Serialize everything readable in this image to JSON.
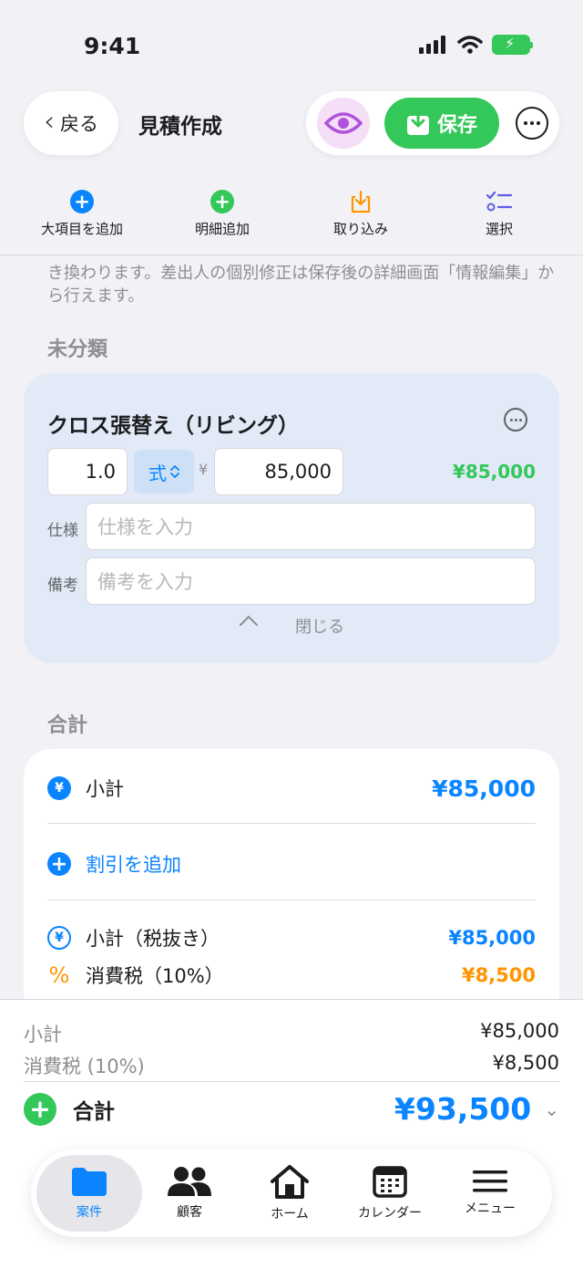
{
  "status": {
    "time": "9:41"
  },
  "nav": {
    "back_label": "戻る",
    "title": "見積作成",
    "save_label": "保存"
  },
  "toolbar": {
    "add_major": "大項目を追加",
    "add_detail": "明細追加",
    "import": "取り込み",
    "select": "選択"
  },
  "note": "き換わります。差出人の個別修正は保存後の詳細画面「情報編集」から行えます。",
  "section_uncategorized": "未分類",
  "item": {
    "name": "クロス張替え（リビング）",
    "quantity": "1.0",
    "unit": "式",
    "yen": "¥",
    "price": "85,000",
    "line_total": "¥85,000",
    "spec_label": "仕様",
    "spec_placeholder": "仕様を入力",
    "memo_label": "備考",
    "memo_placeholder": "備考を入力",
    "close_label": "閉じる"
  },
  "section_total": "合計",
  "totals": {
    "subtotal_label": "小計",
    "subtotal_value": "¥85,000",
    "add_discount": "割引を追加",
    "subtotal_ex_tax_label": "小計（税抜き）",
    "subtotal_ex_tax_value": "¥85,000",
    "tax_label": "消費税（10%）",
    "tax_value": "¥8,500",
    "yen_symbol": "¥",
    "percent_symbol": "%"
  },
  "summary": {
    "subtotal_label": "小計",
    "subtotal_value": "¥85,000",
    "tax_label": "消費税 (10%)",
    "tax_value": "¥8,500",
    "grand_label": "合計",
    "grand_value": "¥93,500"
  },
  "tabs": [
    {
      "label": "案件"
    },
    {
      "label": "顧客"
    },
    {
      "label": "ホーム"
    },
    {
      "label": "カレンダー"
    },
    {
      "label": "メニュー"
    }
  ],
  "colors": {
    "accent": "#0a84ff",
    "green": "#34c759",
    "orange": "#ff9500",
    "purple": "#af52de"
  }
}
